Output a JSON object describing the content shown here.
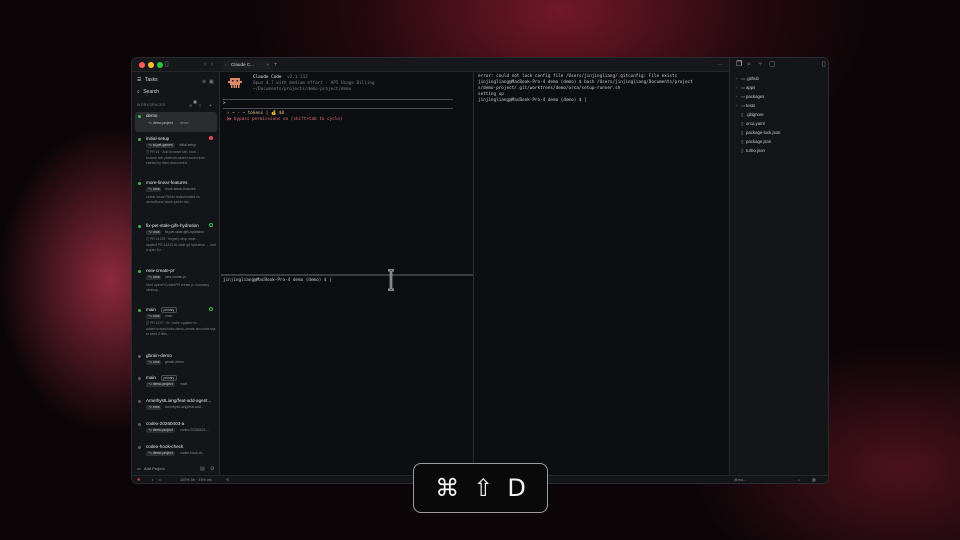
{
  "sidebar": {
    "tasks_label": "Tasks",
    "search_label": "Search",
    "workspaces_header": "WORKSPACES",
    "workspaces_count": "2",
    "add_project_label": "Add Project",
    "workspaces": [
      {
        "name": "demo",
        "chip": "demo-project",
        "sub": "demo"
      },
      {
        "name": "initial-setup",
        "chip": "ai-pet-games",
        "sub": "initial-setup",
        "pr": "PR #1 · Add browser tab, boot...",
        "desc": "browse tab: platform.cases loaded from started by them discovered..."
      },
      {
        "name": "more-linear-features",
        "chip": "orca",
        "sub": "more-linear-features",
        "desc": "Linear Issue Picker reassembled en demo/linear-issue-picker.md..."
      },
      {
        "name": "fix-pet-stale-gifs-hydration",
        "chip": "orca",
        "sub": "fix-pet-stale-gifs-hydration",
        "pr": "PR #1233 · fix(pet): drop stale...",
        "desc": "applied PR #1233 fix stale gif hydration → add a spec for..."
      },
      {
        "name": "new-create-pr",
        "chip": "orca",
        "sub": "new-create-pr",
        "desc": "fixed openPrCreatePR create pr summary cleanup..."
      },
      {
        "name": "main",
        "badge": "primary",
        "chip": "orca",
        "sub": "main",
        "pr": "PR #270 · fix: make updater re...",
        "desc": "added scripts/bake-demo-create-accounts.mjs to seed 3 files..."
      },
      {
        "name": "gbrain-demo",
        "chip": "orca",
        "sub": "gbrain-demo"
      },
      {
        "name": "main",
        "badge": "primary",
        "chip": "demo-project",
        "sub": "main"
      },
      {
        "name": "AmethystLiang/feat-add-agent...",
        "chip": "orca",
        "sub": "AmethystLiang/feat-add..."
      },
      {
        "name": "codex-20260403-a",
        "chip": "demo-project",
        "sub": "codex-20260403-..."
      },
      {
        "name": "codex-hook-check",
        "chip": "demo-project",
        "sub": "codex-hook-ch..."
      }
    ]
  },
  "tabs": {
    "active_tab": "Claude C..."
  },
  "terminal_top_left": {
    "title": "Claude Code",
    "version": "v2.1.112",
    "model_line": "Opus 4.7 with medium effort · API Usage Billing",
    "path_line": "~/Documents/projects/demo-project/demo",
    "prompt": ">",
    "status_line": "⚡ ~ - ~ tokens | 💰 $0",
    "bypass_line": "⏵⏵ bypass permissions on (shift+tab to cycle)"
  },
  "terminal_bottom_left": {
    "prompt": "jinjingliang@MacBook-Pro-4 demo (demo) $ |"
  },
  "terminal_right": {
    "lines": [
      "error: could not lock config file /Users/jinjingliang/.gitconfig: File exists",
      "jinjingliang@MacBook-Pro-4 demo (demo) $ bash /Users/jinjingliang/Documents/project",
      "s/demo-project/.git/worktrees/demo/orca/setup-runner.sh",
      "setting up",
      "jinjingliang@MacBook-Pro-4 demo (demo) $ |"
    ]
  },
  "explorer": {
    "items": [
      {
        "name": ".github",
        "type": "folder"
      },
      {
        "name": "apps",
        "type": "folder"
      },
      {
        "name": "packages",
        "type": "folder"
      },
      {
        "name": "tests",
        "type": "folder"
      },
      {
        "name": ".gitignore",
        "type": "file"
      },
      {
        "name": "orca.yaml",
        "type": "file"
      },
      {
        "name": "package-lock.json",
        "type": "file"
      },
      {
        "name": "package.json",
        "type": "file"
      },
      {
        "name": "turbo.json",
        "type": "file"
      }
    ]
  },
  "statusbar": {
    "usage": "100% 5h · 45% wk",
    "branch": "@ma..."
  },
  "shortcut": {
    "keys": [
      "⌘",
      "⇧",
      "D"
    ]
  },
  "colors": {
    "accent_green": "#3fb950",
    "status_red": "#e5484d",
    "terminal_bg": "#0d0e12"
  }
}
